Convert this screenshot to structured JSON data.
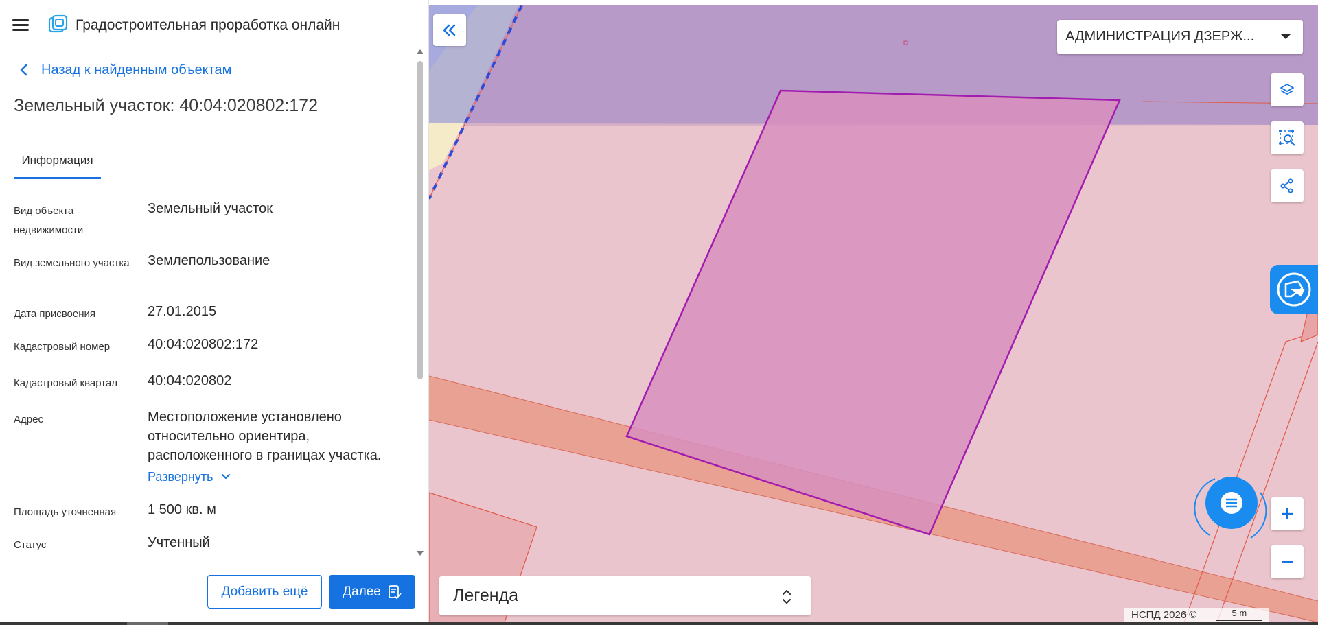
{
  "app": {
    "title": "Градостроительная проработка онлайн"
  },
  "panel": {
    "back_label": "Назад к найденным объектам",
    "object_title": "Земельный участок: 40:04:020802:172",
    "tabs": [
      {
        "label": "Информация",
        "active": true
      }
    ],
    "properties": [
      {
        "label": "Вид объекта недвижимости",
        "value": "Земельный участок"
      },
      {
        "label": "Вид земельного участка",
        "value": "Землепользование"
      },
      {
        "label": "Дата присвоения",
        "value": "27.01.2015"
      },
      {
        "label": "Кадастровый номер",
        "value": "40:04:020802:172"
      },
      {
        "label": "Кадастровый квартал",
        "value": "40:04:020802"
      },
      {
        "label": "Адрес",
        "value": "Местоположение установлено относительно ориентира, расположенного в границах участка.",
        "expand_label": "Развернуть"
      },
      {
        "label": "Площадь уточненная",
        "value": "1 500 кв. м"
      },
      {
        "label": "Статус",
        "value": "Учтенный"
      }
    ],
    "buttons": {
      "add_more": "Добавить ещё",
      "next": "Далее"
    }
  },
  "map": {
    "admin_select": "АДМИНИСТРАЦИЯ ДЗЕРЖ...",
    "legend_label": "Легенда",
    "attribution": "НСПД 2026 ©",
    "scale_label": "5 m",
    "tools": [
      "layers-icon",
      "area-search-icon",
      "share-icon"
    ],
    "colors": {
      "accent": "#1672e0",
      "parcel_stroke": "#a21caf",
      "parcel_fill": "#d88fbd",
      "zone_purple": "#b89ac8",
      "road": "#e9a193",
      "background": "#ebc5cd"
    }
  }
}
